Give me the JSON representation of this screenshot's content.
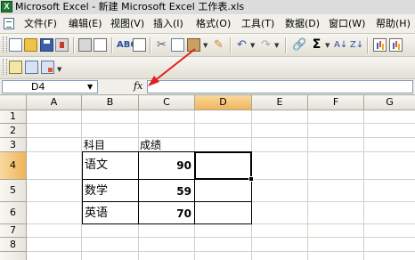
{
  "window": {
    "title": "Microsoft Excel - 新建 Microsoft Excel 工作表.xls",
    "app_icon_letter": "X"
  },
  "menu": [
    "文件(F)",
    "编辑(E)",
    "视图(V)",
    "插入(I)",
    "格式(O)",
    "工具(T)",
    "数据(D)",
    "窗口(W)",
    "帮助(H)"
  ],
  "toolbar": {
    "sum_label": "Σ"
  },
  "formula_bar": {
    "name_box": "D4",
    "fx_label": "fx",
    "formula_value": ""
  },
  "columns": [
    "A",
    "B",
    "C",
    "D",
    "E",
    "F",
    "G"
  ],
  "rows": [
    "1",
    "2",
    "3",
    "4",
    "5",
    "6",
    "7",
    "8"
  ],
  "cells": {
    "B3": "科目",
    "C3": "成绩",
    "B4": "语文",
    "C4": "90",
    "B5": "数学",
    "C5": "59",
    "B6": "英语",
    "C6": "70"
  },
  "selection": {
    "active_cell": "D4",
    "selected_column": "D",
    "selected_row": "4"
  },
  "colors": {
    "arrow": "#e0211f",
    "selected_header": "#f5c26f",
    "grid": "#d4d0c8"
  }
}
